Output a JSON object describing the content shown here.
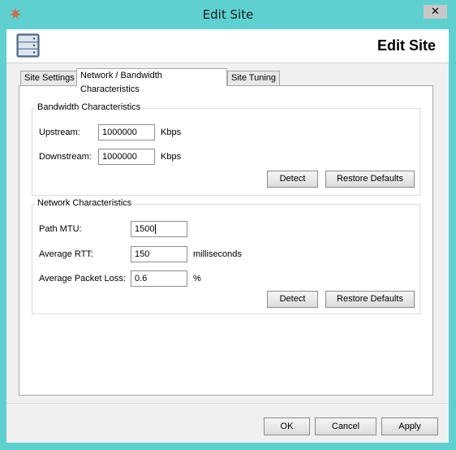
{
  "window": {
    "title": "Edit Site"
  },
  "header": {
    "title": "Edit Site"
  },
  "tabs": [
    {
      "label": "Site Settings"
    },
    {
      "label": "Network / Bandwidth Characteristics"
    },
    {
      "label": "Site Tuning"
    }
  ],
  "bandwidth": {
    "title": "Bandwidth Characteristics",
    "upstream": {
      "label": "Upstream:",
      "value": "1000000",
      "unit": "Kbps"
    },
    "downstream": {
      "label": "Downstream:",
      "value": "1000000",
      "unit": "Kbps"
    },
    "detect_label": "Detect",
    "restore_label": "Restore Defaults"
  },
  "network": {
    "title": "Network Characteristics",
    "mtu": {
      "label": "Path MTU:",
      "value": "1500"
    },
    "rtt": {
      "label": "Average RTT:",
      "value": "150",
      "unit": "milliseconds"
    },
    "loss": {
      "label": "Average Packet Loss:",
      "value": "0.6",
      "unit": "%"
    },
    "detect_label": "Detect",
    "restore_label": "Restore Defaults"
  },
  "footer": {
    "ok_label": "OK",
    "cancel_label": "Cancel",
    "apply_label": "Apply"
  },
  "colors": {
    "frame": "#5ed0d0",
    "close_button": "#c7c7c7"
  }
}
